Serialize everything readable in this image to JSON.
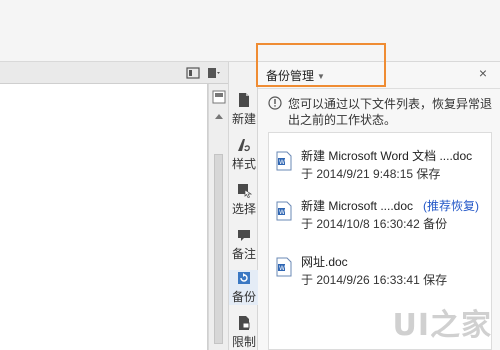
{
  "task_pane": {
    "title": "备份管理",
    "close_icon": "close-icon",
    "tabs": [
      {
        "label": "新建",
        "icon": "new-doc-icon"
      },
      {
        "label": "样式",
        "icon": "style-icon"
      },
      {
        "label": "选择",
        "icon": "select-icon"
      },
      {
        "label": "备注",
        "icon": "comment-icon"
      },
      {
        "label": "备份",
        "icon": "backup-icon"
      },
      {
        "label": "限制",
        "icon": "restrict-icon"
      }
    ],
    "info": "您可以通过以下文件列表，恢复异常退出之前的工作状态。",
    "items": [
      {
        "name": "新建 Microsoft Word 文档 ....doc",
        "meta": "于 2014/9/21 9:48:15 保存",
        "recommend": ""
      },
      {
        "name": "新建 Microsoft ....doc",
        "meta": "于 2014/10/8 16:30:42 备份",
        "recommend": "(推荐恢复)"
      },
      {
        "name": "网址.doc",
        "meta": "于 2014/9/26 16:33:41 保存",
        "recommend": ""
      }
    ]
  },
  "colors": {
    "highlight_border": "#ef8c33",
    "recommend_text": "#2458c8"
  },
  "watermark": "UI之家"
}
